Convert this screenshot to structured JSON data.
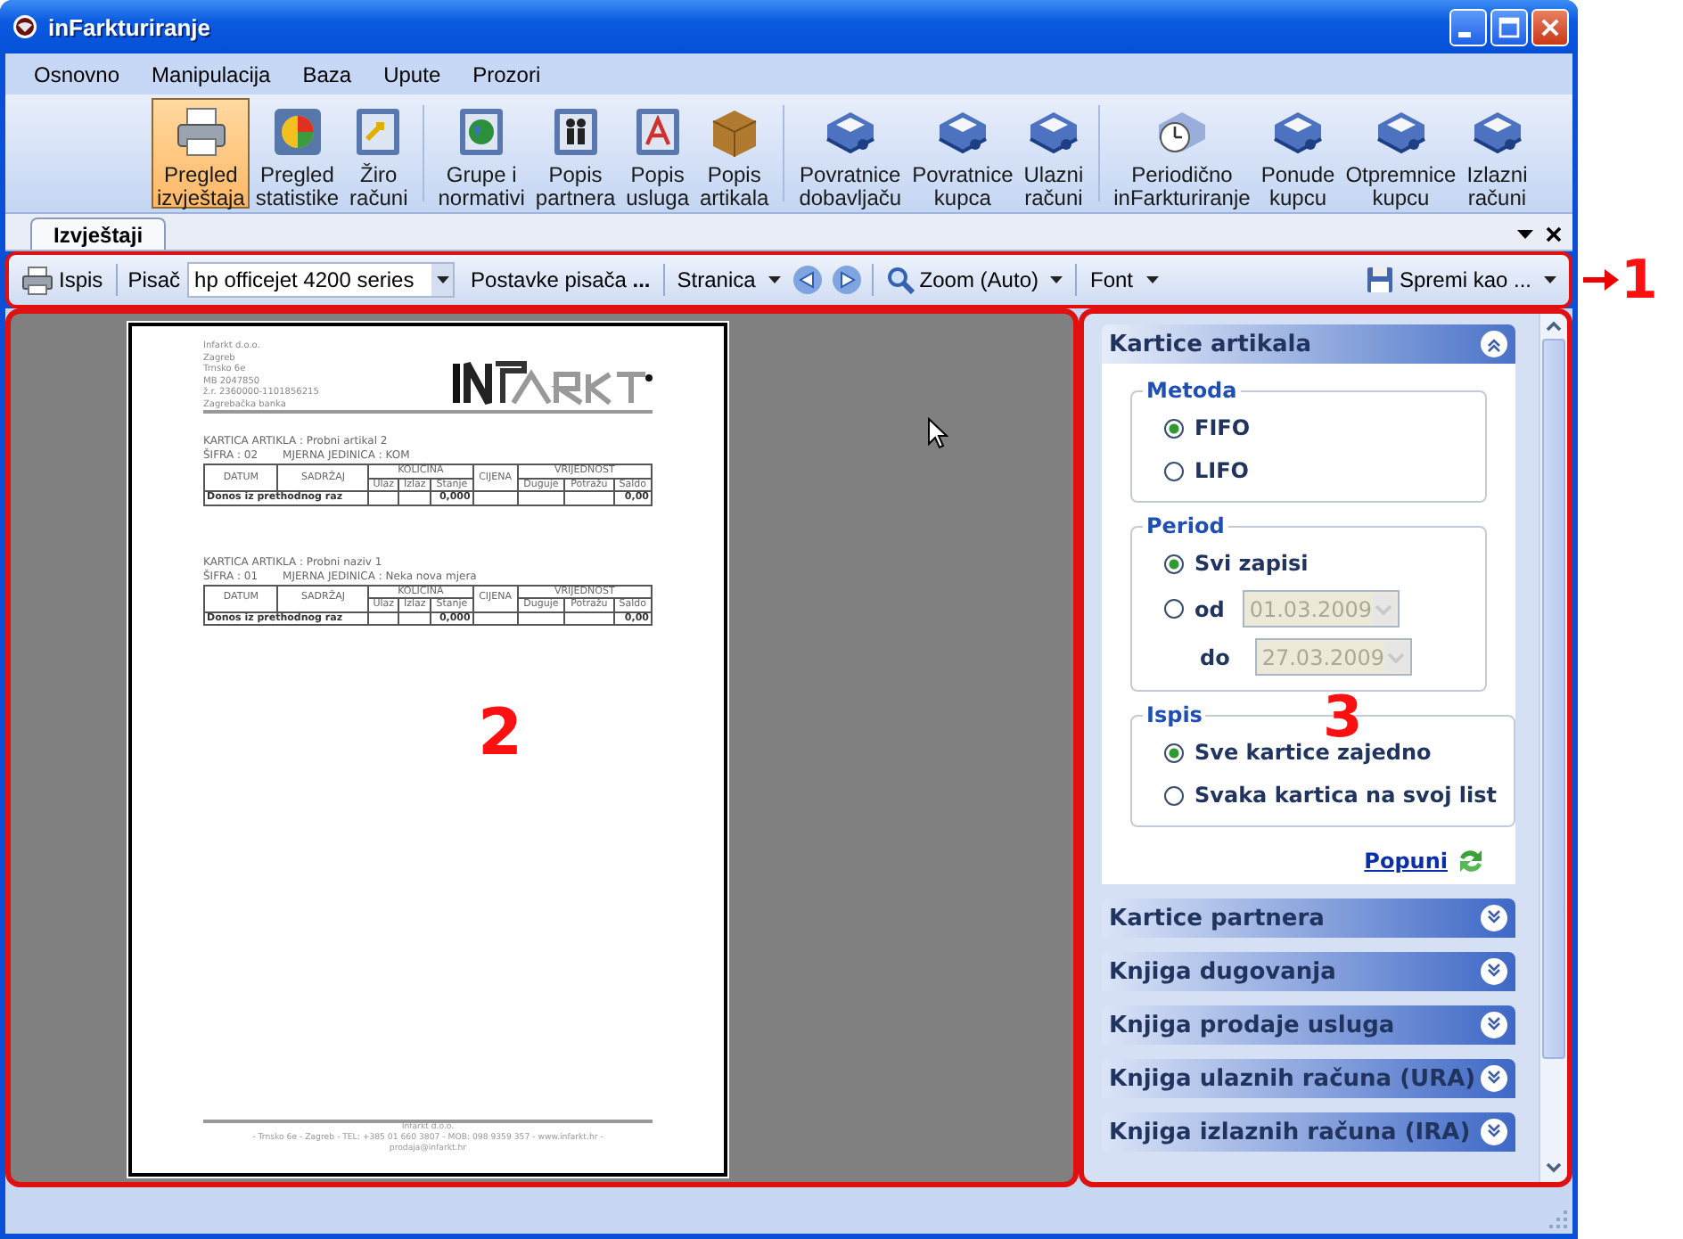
{
  "window": {
    "title": "inFarkturiranje"
  },
  "menu": [
    {
      "label": "Osnovno"
    },
    {
      "label": "Manipulacija"
    },
    {
      "label": "Baza"
    },
    {
      "label": "Upute"
    },
    {
      "label": "Prozori"
    }
  ],
  "ribbon": [
    [
      {
        "kind": "printer",
        "lines": [
          "Pregled",
          "izvještaja"
        ],
        "selected": true
      },
      {
        "kind": "chart",
        "lines": [
          "Pregled",
          "statistike"
        ],
        "selected": false
      },
      {
        "kind": "transfer",
        "lines": [
          "Žiro",
          "računi"
        ],
        "selected": false
      }
    ],
    [
      {
        "kind": "globe",
        "lines": [
          "Grupe i",
          "normativi"
        ],
        "selected": false
      },
      {
        "kind": "people",
        "lines": [
          "Popis",
          "partnera"
        ],
        "selected": false
      },
      {
        "kind": "letter",
        "lines": [
          "Popis",
          "usluga"
        ],
        "selected": false
      },
      {
        "kind": "box",
        "lines": [
          "Popis",
          "artikala"
        ],
        "selected": false
      }
    ],
    [
      {
        "kind": "tray",
        "lines": [
          "Povratnice",
          "dobavljaču"
        ],
        "selected": false
      },
      {
        "kind": "tray",
        "lines": [
          "Povratnice",
          "kupca"
        ],
        "selected": false
      },
      {
        "kind": "tray",
        "lines": [
          "Ulazni",
          "računi"
        ],
        "selected": false
      }
    ],
    [
      {
        "kind": "clock",
        "lines": [
          "Periodično",
          "inFarkturiranje"
        ],
        "selected": false
      },
      {
        "kind": "tray",
        "lines": [
          "Ponude",
          "kupcu"
        ],
        "selected": false
      },
      {
        "kind": "tray",
        "lines": [
          "Otpremnice",
          "kupcu"
        ],
        "selected": false
      },
      {
        "kind": "tray",
        "lines": [
          "Izlazni",
          "računi"
        ],
        "selected": false
      }
    ]
  ],
  "tabs": [
    {
      "label": "Izvještaji",
      "selected": true
    }
  ],
  "print_toolbar": [
    {
      "kind": "print",
      "label": "Ispis"
    },
    {
      "kind": "separator"
    },
    {
      "kind": "label",
      "label": "Pisač"
    },
    {
      "kind": "select",
      "value": "hp officejet 4200 series"
    },
    {
      "kind": "settings",
      "label": "Postavke pisača **...**"
    },
    {
      "kind": "separator"
    },
    {
      "kind": "dropdown",
      "label": "Stranica"
    },
    {
      "kind": "nav"
    },
    {
      "kind": "separator"
    },
    {
      "kind": "zoom",
      "label": "Zoom (Auto)"
    },
    {
      "kind": "separator"
    },
    {
      "kind": "dropdown",
      "label": "Font"
    },
    {
      "kind": "spacer"
    },
    {
      "kind": "save",
      "label": "Spremi kao ..."
    }
  ],
  "document": {
    "company": [
      "Infarkt d.o.o.",
      "Zagreb",
      "Trnsko 6e",
      "MB 2047850",
      "ž.r. 2360000-1101856215",
      "Zagrebačka banka"
    ],
    "cards": [
      {
        "title": "KARTICA ARTIKLA : Probni artikal 2",
        "code": "ŠIFRA : 02",
        "unit": "MJERNA JEDINICA : KOM",
        "columns": [
          "DATUM",
          "SADRŽAJ",
          "KOLIČINA",
          "CIJENA",
          "VRIJEDNOST"
        ],
        "subcolumns": [
          "Ulaz",
          "Izlaz",
          "Stanje",
          "Duguje",
          "Potražu",
          "Saldo"
        ],
        "row": [
          "Donos iz prethodnog raz",
          "0,000",
          "0,00"
        ]
      },
      {
        "title": "KARTICA ARTIKLA : Probni naziv 1",
        "code": "ŠIFRA : 01",
        "unit": "MJERNA JEDINICA : Neka nova mjera",
        "columns": [
          "DATUM",
          "SADRŽAJ",
          "KOLIČINA",
          "CIJENA",
          "VRIJEDNOST"
        ],
        "subcolumns": [
          "Ulaz",
          "Izlaz",
          "Stanje",
          "Duguje",
          "Potražu",
          "Saldo"
        ],
        "row": [
          "Donos iz prethodnog raz",
          "0,000",
          "0,00"
        ]
      }
    ],
    "footer": [
      "Infarkt d.o.o.",
      "- Trnsko 6e - Zagreb - TEL: +385 01 660 3807 - MOB: 098 9359 357 - www.infarkt.hr -",
      "prodaja@infarkt.hr"
    ]
  },
  "report_panel": [
    {
      "title": "Kartice artikala",
      "expanded": true,
      "groups": [
        {
          "legend": "Metoda",
          "options": [
            {
              "label": "FIFO",
              "selected": true
            },
            {
              "label": "LIFO",
              "selected": false
            }
          ]
        },
        {
          "legend": "Period",
          "options": [
            {
              "label": "Svi zapisi",
              "selected": true
            },
            {
              "label": "od",
              "selected": false,
              "date": {
                "value": "01.03.2009",
                "disabled": true
              }
            }
          ],
          "extra": {
            "label": "do",
            "date": {
              "value": "27.03.2009",
              "disabled": true
            }
          }
        },
        {
          "legend": "Ispis",
          "options": [
            {
              "label": "Sve kartice zajedno",
              "selected": true
            },
            {
              "label": "Svaka kartica na svoj list",
              "selected": false
            }
          ]
        }
      ],
      "link": "Popuni"
    },
    {
      "title": "Kartice partnera",
      "expanded": false
    },
    {
      "title": "Knjiga dugovanja",
      "expanded": false
    },
    {
      "title": "Knjiga prodaje usluga",
      "expanded": false
    },
    {
      "title": "Knjiga ulaznih računa (URA)",
      "expanded": false
    },
    {
      "title": "Knjiga izlaznih računa (IRA)",
      "expanded": false
    }
  ],
  "annotations": [
    {
      "label": "1"
    },
    {
      "label": "2"
    },
    {
      "label": "3"
    }
  ]
}
